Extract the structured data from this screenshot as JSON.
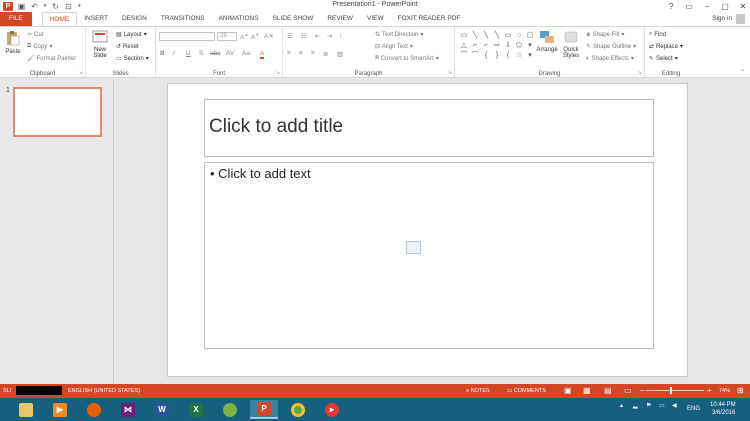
{
  "window": {
    "title": "Presentation1 - PowerPoint",
    "controls": [
      "?",
      "▭",
      "–",
      "▢",
      "✕"
    ]
  },
  "tabs": [
    {
      "label": "FILE"
    },
    {
      "label": "HOME"
    },
    {
      "label": "INSERT"
    },
    {
      "label": "DESIGN"
    },
    {
      "label": "TRANSITIONS"
    },
    {
      "label": "ANIMATIONS"
    },
    {
      "label": "SLIDE SHOW"
    },
    {
      "label": "REVIEW"
    },
    {
      "label": "VIEW"
    },
    {
      "label": "FOXIT READER PDF"
    }
  ],
  "signin": "Sign in",
  "ribbon": {
    "clipboard": {
      "label": "Clipboard",
      "paste": "Paste",
      "cut": "Cut",
      "copy": "Copy",
      "format_painter": "Format Painter"
    },
    "slides": {
      "label": "Slides",
      "new_slide_1": "New",
      "new_slide_2": "Slide",
      "layout": "Layout",
      "reset": "Reset",
      "section": "Section"
    },
    "font": {
      "label": "Font",
      "size": "28",
      "bold": "B",
      "italic": "I",
      "underline": "U",
      "shadow": "S",
      "strike": "abc",
      "spacing": "AV",
      "case": "Aa",
      "color": "A"
    },
    "paragraph": {
      "label": "Paragraph",
      "text_direction": "Text Direction",
      "align_text": "Align Text",
      "smartart": "Convert to SmartArt"
    },
    "drawing": {
      "label": "Drawing",
      "arrange": "Arrange",
      "quick_styles_1": "Quick",
      "quick_styles_2": "Styles",
      "shape_fill": "Shape Fill",
      "shape_outline": "Shape Outline",
      "shape_effects": "Shape Effects"
    },
    "editing": {
      "label": "Editing",
      "find": "Find",
      "replace": "Replace",
      "select": "Select"
    }
  },
  "thumbnails": {
    "number": "1"
  },
  "slide": {
    "title_placeholder": "Click to add title",
    "body_placeholder": "• Click to add text"
  },
  "statusbar": {
    "slide_info": "SLI",
    "language": "ENGLISH (UNITED STATES)",
    "notes": "NOTES",
    "comments": "COMMENTS",
    "zoom": "74%",
    "zoom_minus": "–",
    "zoom_plus": "+"
  },
  "taskbar": {
    "language": "ENG",
    "time": "10:44 PM",
    "date": "3/6/2016"
  },
  "colors": {
    "accent": "#d24726",
    "taskbar": "#14607e"
  }
}
